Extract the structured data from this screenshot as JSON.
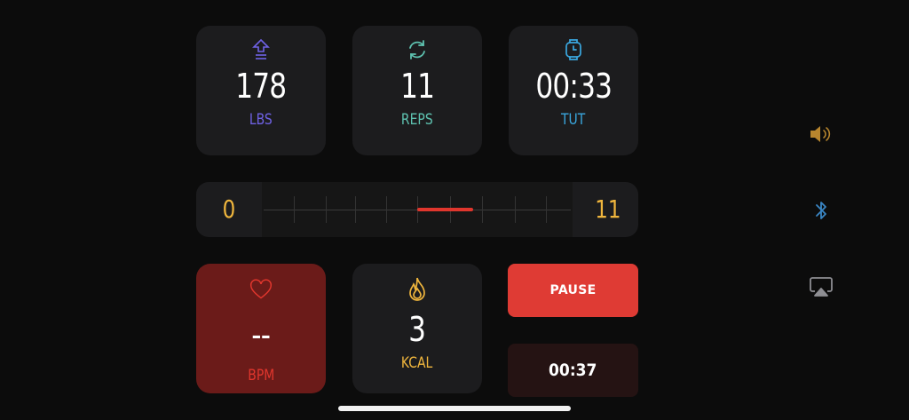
{
  "stats": {
    "weight": {
      "value": "178",
      "label": "LBS",
      "icon": "weight-up-icon",
      "color": "#6f62e6"
    },
    "reps": {
      "value": "11",
      "label": "REPS",
      "icon": "repeat-cycle-icon",
      "color": "#5ec2b0"
    },
    "tut": {
      "value": "00:33",
      "label": "TUT",
      "icon": "watch-icon",
      "color": "#3aa8e0"
    }
  },
  "rep_range": {
    "min_label": "0",
    "max_label": "11",
    "marker_start_fraction": 0.5,
    "marker_end_fraction": 0.68,
    "color": "#f0b63d",
    "marker_color": "#e0362d"
  },
  "heart_rate": {
    "value": "--",
    "label": "BPM",
    "icon": "heart-icon",
    "color": "#e0362d"
  },
  "calories": {
    "value": "3",
    "label": "KCAL",
    "icon": "flame-icon",
    "color": "#f0b63d"
  },
  "controls": {
    "pause_label": "PAUSE",
    "elapsed_time": "00:37"
  },
  "side_icons": [
    "speaker-icon",
    "bluetooth-icon",
    "airplay-icon"
  ]
}
